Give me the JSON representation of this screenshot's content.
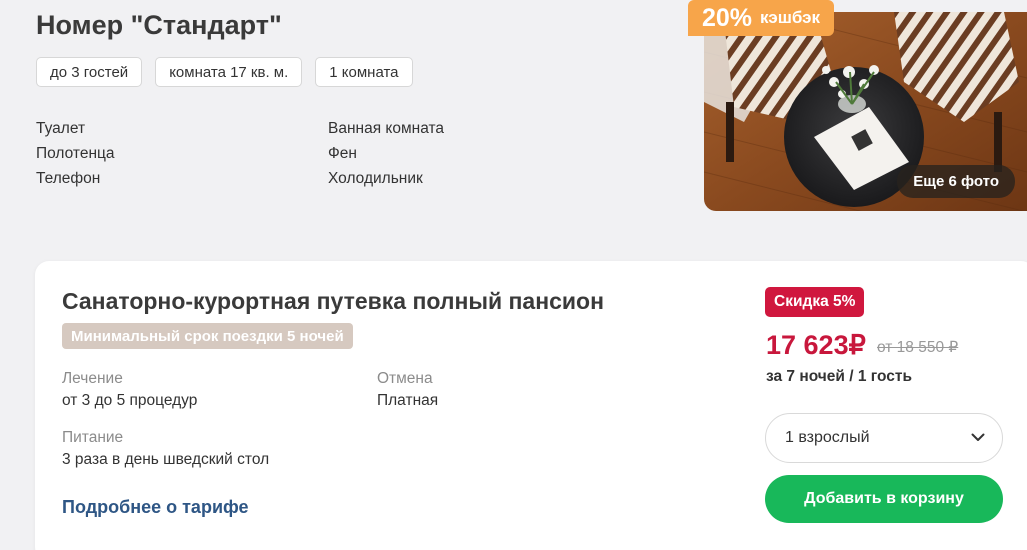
{
  "room": {
    "title": "Номер \"Стандарт\"",
    "chips": [
      "до 3 гостей",
      "комната 17 кв. м.",
      "1 комната"
    ],
    "amenities_left": [
      "Туалет",
      "Полотенца",
      "Телефон"
    ],
    "amenities_right": [
      "Ванная комната",
      "Фен",
      "Холодильник"
    ],
    "cashback_percent": "20%",
    "cashback_label": "кэшбэк",
    "more_photos": "Еще 6 фото"
  },
  "tariff": {
    "title": "Санаторно-курортная путевка полный пансион",
    "min_stay": "Минимальный срок поездки 5 ночей",
    "treatment_label": "Лечение",
    "treatment_value": "от 3 до 5 процедур",
    "cancel_label": "Отмена",
    "cancel_value": "Платная",
    "meals_label": "Питание",
    "meals_value": "3 раза в день шведский стол",
    "more_link": "Подробнее о тарифе",
    "discount": "Скидка 5%",
    "price": "17 623₽",
    "old_price": "от 18 550 ₽",
    "price_note": "за 7 ночей / 1 гость",
    "guests_selected": "1 взрослый",
    "add_button": "Добавить в корзину"
  },
  "colors": {
    "cashback": "#f7a54a",
    "discount": "#d0173e",
    "price": "#c8173c",
    "add_button": "#18b85a",
    "link": "#2e5685"
  },
  "icons": {
    "select_arrow": "chevron-down-icon"
  }
}
